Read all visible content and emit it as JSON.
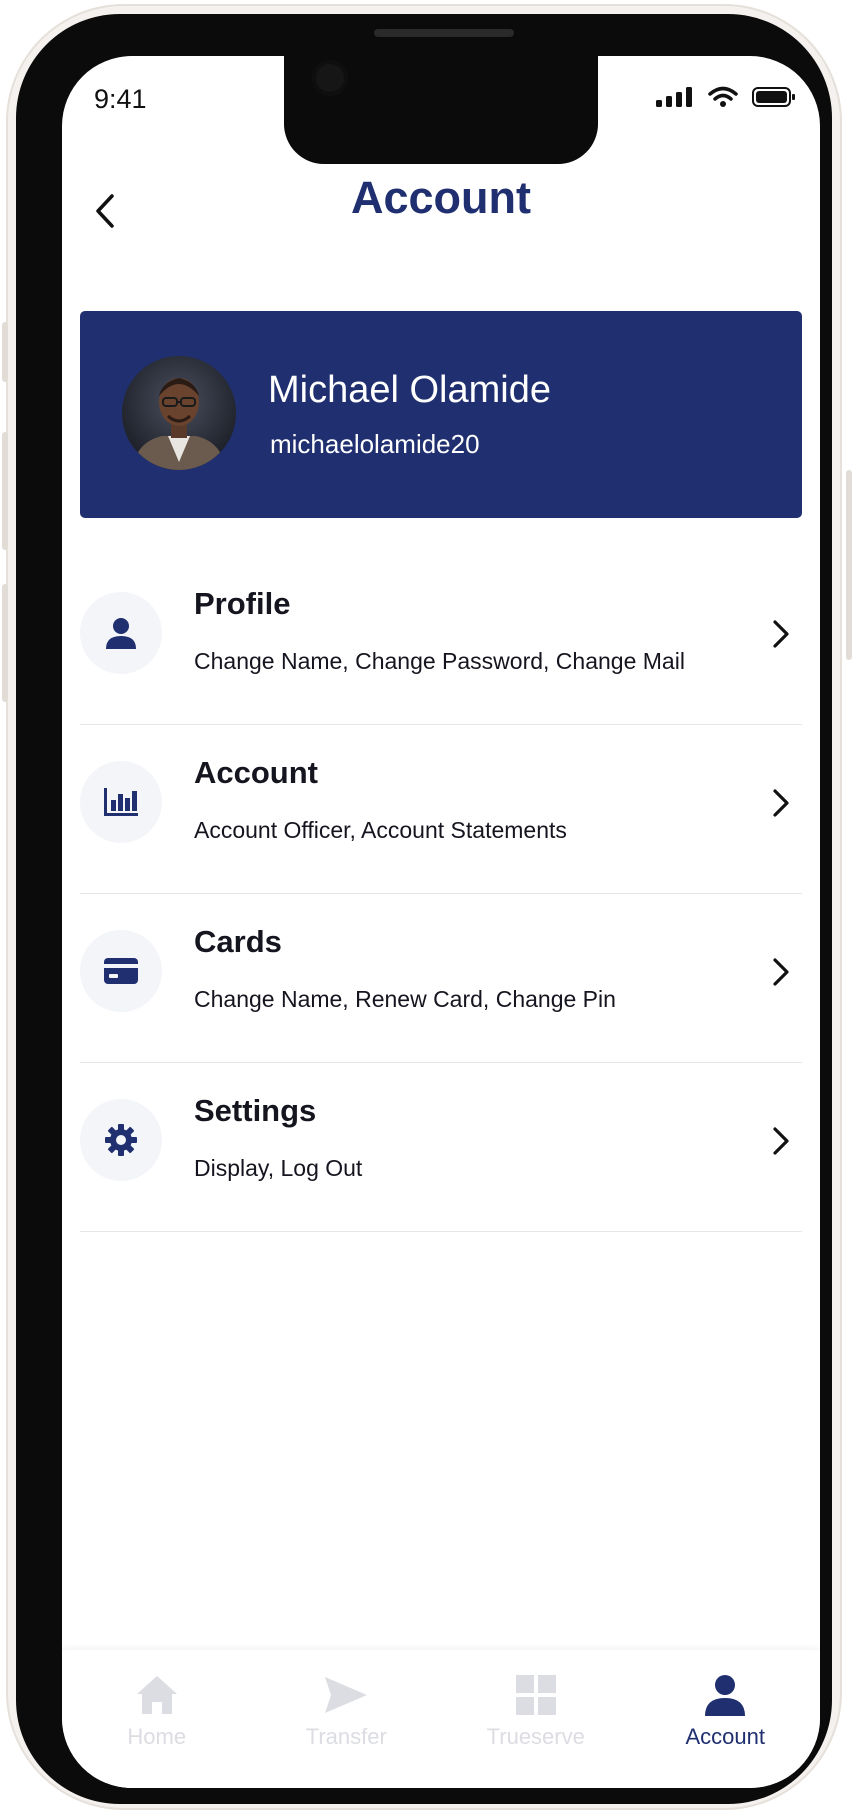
{
  "status_bar": {
    "time": "9:41"
  },
  "header": {
    "title": "Account"
  },
  "profile": {
    "name": "Michael Olamide",
    "username": "michaelolamide20"
  },
  "menu": {
    "items": [
      {
        "title": "Profile",
        "subtitle": "Change Name, Change Password, Change Mail",
        "icon": "person-icon"
      },
      {
        "title": "Account",
        "subtitle": "Account Officer, Account Statements",
        "icon": "bar-chart-icon"
      },
      {
        "title": "Cards",
        "subtitle": "Change Name, Renew Card, Change Pin",
        "icon": "card-icon"
      },
      {
        "title": "Settings",
        "subtitle": "Display, Log Out",
        "icon": "gear-icon"
      }
    ]
  },
  "bottom_nav": {
    "items": [
      {
        "label": "Home",
        "icon": "home-icon",
        "active": false
      },
      {
        "label": "Transfer",
        "icon": "send-icon",
        "active": false
      },
      {
        "label": "Trueserve",
        "icon": "grid-icon",
        "active": false
      },
      {
        "label": "Account",
        "icon": "person-icon",
        "active": true
      }
    ]
  },
  "colors": {
    "primary": "#1f2f6f",
    "inactive_nav": "#dcdde2",
    "icon_bg": "#f3f5f8"
  }
}
